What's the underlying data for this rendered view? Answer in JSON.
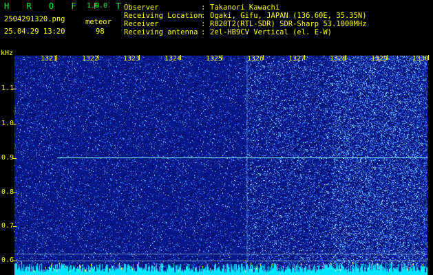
{
  "app": {
    "title": "H R O F F T",
    "version": "1.0.0",
    "filename": "2504291320.png",
    "datetime": "25.04.29 13:20",
    "detection_label": "meteor",
    "detection_count": "98"
  },
  "info": [
    {
      "label": "Observer",
      "value": "Takanori Kawachi"
    },
    {
      "label": "Receiving Location",
      "value": "Ogaki, Gifu, JAPAN (136.60E, 35.35N)"
    },
    {
      "label": "Receiver",
      "value": "R820T2(RTL-SDR) SDR-Sharp 53.1000MHz"
    },
    {
      "label": "Receiving antenna",
      "value": "2el-HB9CV Vertical (el. E-W)"
    }
  ],
  "separator": ":",
  "axis": {
    "y_unit": "kHz",
    "y_ticks": [
      "1.1",
      "1.0",
      "0.9",
      "0.8",
      "0.7",
      "0.6"
    ],
    "x_ticks": [
      "1321",
      "1322",
      "1323",
      "1324",
      "1325",
      "1326",
      "1327",
      "1328",
      "1329",
      "1330"
    ]
  },
  "colors": {
    "background": "#000000",
    "text": "#ffff00",
    "title": "#00ff3c",
    "spectrogram_base": "#0a1a8c",
    "spectrogram_noise": "#4f8cff",
    "carrier_line": "#8ff8ff",
    "bottom_band": "#00e5ff"
  }
}
